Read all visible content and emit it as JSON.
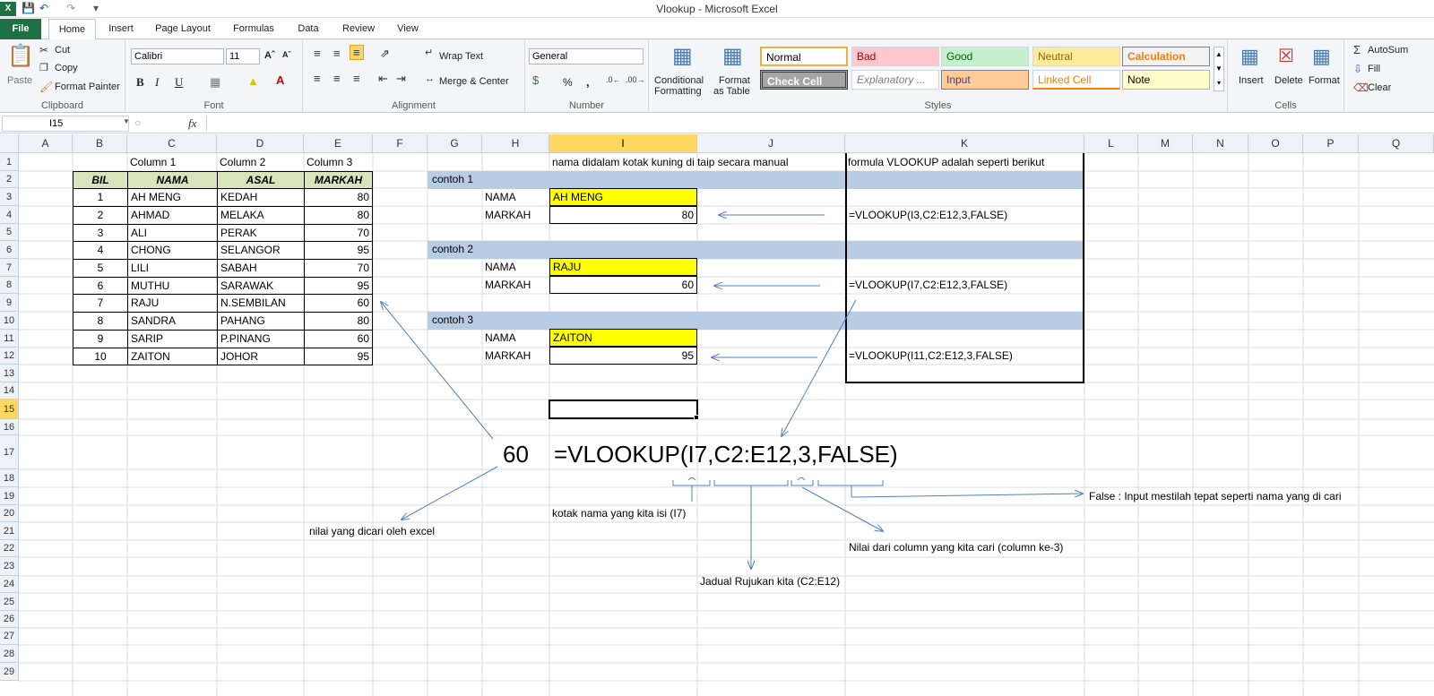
{
  "window": {
    "title": "Vlookup  -  Microsoft Excel",
    "app_icon": "X"
  },
  "tabs": [
    "File",
    "Home",
    "Insert",
    "Page Layout",
    "Formulas",
    "Data",
    "Review",
    "View"
  ],
  "ribbon": {
    "clipboard": {
      "paste": "Paste",
      "cut": "Cut",
      "copy": "Copy",
      "format_painter": "Format Painter",
      "label": "Clipboard"
    },
    "font": {
      "name": "Calibri",
      "size": "11",
      "bold": "B",
      "italic": "I",
      "underline": "U",
      "label": "Font"
    },
    "alignment": {
      "wrap": "Wrap Text",
      "merge": "Merge & Center",
      "label": "Alignment"
    },
    "number": {
      "format": "General",
      "pct": "%",
      "comma": ",",
      "label": "Number"
    },
    "styles": {
      "conditional": "Conditional",
      "conditional2": "Formatting",
      "format_table": "Format",
      "format_table2": "as Table",
      "normal": "Normal",
      "bad": "Bad",
      "good": "Good",
      "neutral": "Neutral",
      "calculation": "Calculation",
      "check": "Check Cell",
      "explanatory": "Explanatory ...",
      "input": "Input",
      "linked": "Linked Cell",
      "note": "Note",
      "label": "Styles"
    },
    "cells": {
      "insert": "Insert",
      "delete": "Delete",
      "format": "Format",
      "label": "Cells"
    },
    "editing": {
      "autosum": "AutoSum",
      "fill": "Fill",
      "clear": "Clear"
    }
  },
  "formula_bar": {
    "name_box": "I15",
    "fx": "fx",
    "content": ""
  },
  "columns": [
    "A",
    "B",
    "C",
    "D",
    "E",
    "F",
    "G",
    "H",
    "I",
    "J",
    "K",
    "L",
    "M",
    "N",
    "O",
    "P",
    "Q"
  ],
  "rows": [
    "1",
    "2",
    "3",
    "4",
    "5",
    "6",
    "7",
    "8",
    "9",
    "10",
    "11",
    "12",
    "13",
    "14",
    "15",
    "16",
    "17",
    "18",
    "19",
    "20",
    "21",
    "22",
    "23",
    "24",
    "25",
    "26",
    "27",
    "28",
    "29"
  ],
  "table": {
    "col_titles": [
      "Column 1",
      "Column 2",
      "Column 3"
    ],
    "headers": [
      "BIL",
      "NAMA",
      "ASAL",
      "MARKAH"
    ],
    "rows": [
      [
        "1",
        "AH MENG",
        "KEDAH",
        "80"
      ],
      [
        "2",
        "AHMAD",
        "MELAKA",
        "80"
      ],
      [
        "3",
        "ALI",
        "PERAK",
        "70"
      ],
      [
        "4",
        "CHONG",
        "SELANGOR",
        "95"
      ],
      [
        "5",
        "LILI",
        "SABAH",
        "70"
      ],
      [
        "6",
        "MUTHU",
        "SARAWAK",
        "95"
      ],
      [
        "7",
        "RAJU",
        "N.SEMBILAN",
        "60"
      ],
      [
        "8",
        "SANDRA",
        "PAHANG",
        "80"
      ],
      [
        "9",
        "SARIP",
        "P.PINANG",
        "60"
      ],
      [
        "10",
        "ZAITON",
        "JOHOR",
        "95"
      ]
    ]
  },
  "notes": {
    "yellow_note": "nama didalam kotak kuning di taip secara manual",
    "formula_note": "formula VLOOKUP adalah seperti berikut"
  },
  "examples": [
    {
      "title": "contoh 1",
      "nama_label": "NAMA",
      "nama": "AH MENG",
      "markah_label": "MARKAH",
      "markah": "80",
      "formula": "=VLOOKUP(I3,C2:E12,3,FALSE)"
    },
    {
      "title": "contoh 2",
      "nama_label": "NAMA",
      "nama": "RAJU",
      "markah_label": "MARKAH",
      "markah": "60",
      "formula": "=VLOOKUP(I7,C2:E12,3,FALSE)"
    },
    {
      "title": "contoh 3",
      "nama_label": "NAMA",
      "nama": "ZAITON",
      "markah_label": "MARKAH",
      "markah": "95",
      "formula": "=VLOOKUP(I11,C2:E12,3,FALSE)"
    }
  ],
  "explain": {
    "result": "60",
    "formula": "=VLOOKUP(I7,C2:E12,3,FALSE)",
    "false_note": "False : Input mestilah tepat seperti nama yang di cari",
    "kotak_note": "kotak nama yang kita isi (I7)",
    "nilai_note": "nilai yang dicari oleh excel",
    "column_note": "Nilai dari column yang kita cari (column ke-3)",
    "jadual_note": "Jadual Rujukan kita (C2:E12)"
  }
}
